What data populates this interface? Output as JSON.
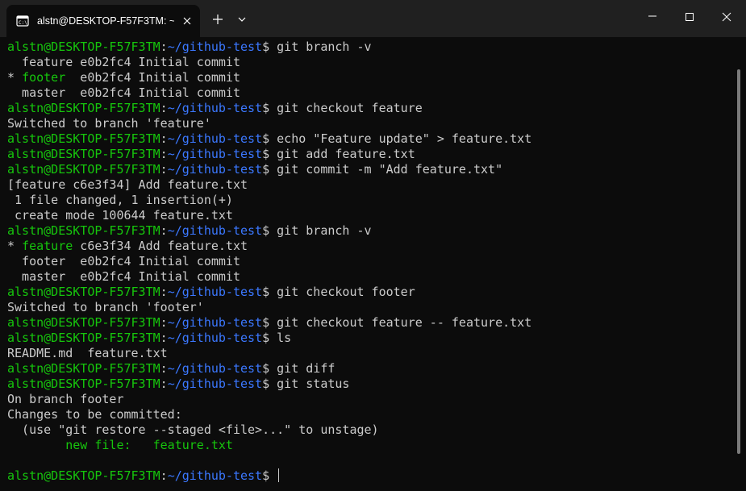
{
  "window": {
    "tab_title": "alstn@DESKTOP-F57F3TM: ~/",
    "tab_icon": "terminal-icon",
    "new_tab_icon": "plus-icon",
    "dropdown_icon": "chevron-down-icon",
    "minimize_icon": "minimize-icon",
    "maximize_icon": "maximize-icon",
    "close_icon": "close-icon"
  },
  "colors": {
    "background": "#0c0c0c",
    "titlebar": "#202020",
    "prompt_user": "#16c60c",
    "prompt_path": "#3b78ff",
    "text": "#cccccc"
  },
  "terminal": {
    "lines": [
      {
        "kind": "prompt",
        "user": "alstn@DESKTOP-F57F3TM",
        "sep": ":",
        "path": "~/github-test",
        "sym": "$ ",
        "cmd": "git branch -v"
      },
      {
        "kind": "out",
        "segs": [
          {
            "t": "  feature e0b2fc4 Initial commit"
          }
        ]
      },
      {
        "kind": "out",
        "segs": [
          {
            "t": "* "
          },
          {
            "t": "footer",
            "c": "green"
          },
          {
            "t": "  e0b2fc4 Initial commit"
          }
        ]
      },
      {
        "kind": "out",
        "segs": [
          {
            "t": "  master  e0b2fc4 Initial commit"
          }
        ]
      },
      {
        "kind": "prompt",
        "user": "alstn@DESKTOP-F57F3TM",
        "sep": ":",
        "path": "~/github-test",
        "sym": "$ ",
        "cmd": "git checkout feature"
      },
      {
        "kind": "out",
        "segs": [
          {
            "t": "Switched to branch 'feature'"
          }
        ]
      },
      {
        "kind": "prompt",
        "user": "alstn@DESKTOP-F57F3TM",
        "sep": ":",
        "path": "~/github-test",
        "sym": "$ ",
        "cmd": "echo \"Feature update\" > feature.txt"
      },
      {
        "kind": "prompt",
        "user": "alstn@DESKTOP-F57F3TM",
        "sep": ":",
        "path": "~/github-test",
        "sym": "$ ",
        "cmd": "git add feature.txt"
      },
      {
        "kind": "prompt",
        "user": "alstn@DESKTOP-F57F3TM",
        "sep": ":",
        "path": "~/github-test",
        "sym": "$ ",
        "cmd": "git commit -m \"Add feature.txt\""
      },
      {
        "kind": "out",
        "segs": [
          {
            "t": "[feature c6e3f34] Add feature.txt"
          }
        ]
      },
      {
        "kind": "out",
        "segs": [
          {
            "t": " 1 file changed, 1 insertion(+)"
          }
        ]
      },
      {
        "kind": "out",
        "segs": [
          {
            "t": " create mode 100644 feature.txt"
          }
        ]
      },
      {
        "kind": "prompt",
        "user": "alstn@DESKTOP-F57F3TM",
        "sep": ":",
        "path": "~/github-test",
        "sym": "$ ",
        "cmd": "git branch -v"
      },
      {
        "kind": "out",
        "segs": [
          {
            "t": "* "
          },
          {
            "t": "feature",
            "c": "green"
          },
          {
            "t": " c6e3f34 Add feature.txt"
          }
        ]
      },
      {
        "kind": "out",
        "segs": [
          {
            "t": "  footer  e0b2fc4 Initial commit"
          }
        ]
      },
      {
        "kind": "out",
        "segs": [
          {
            "t": "  master  e0b2fc4 Initial commit"
          }
        ]
      },
      {
        "kind": "prompt",
        "user": "alstn@DESKTOP-F57F3TM",
        "sep": ":",
        "path": "~/github-test",
        "sym": "$ ",
        "cmd": "git checkout footer"
      },
      {
        "kind": "out",
        "segs": [
          {
            "t": "Switched to branch 'footer'"
          }
        ]
      },
      {
        "kind": "prompt",
        "user": "alstn@DESKTOP-F57F3TM",
        "sep": ":",
        "path": "~/github-test",
        "sym": "$ ",
        "cmd": "git checkout feature -- feature.txt"
      },
      {
        "kind": "prompt",
        "user": "alstn@DESKTOP-F57F3TM",
        "sep": ":",
        "path": "~/github-test",
        "sym": "$ ",
        "cmd": "ls"
      },
      {
        "kind": "out",
        "segs": [
          {
            "t": "README.md  feature.txt"
          }
        ]
      },
      {
        "kind": "prompt",
        "user": "alstn@DESKTOP-F57F3TM",
        "sep": ":",
        "path": "~/github-test",
        "sym": "$ ",
        "cmd": "git diff"
      },
      {
        "kind": "prompt",
        "user": "alstn@DESKTOP-F57F3TM",
        "sep": ":",
        "path": "~/github-test",
        "sym": "$ ",
        "cmd": "git status"
      },
      {
        "kind": "out",
        "segs": [
          {
            "t": "On branch footer"
          }
        ]
      },
      {
        "kind": "out",
        "segs": [
          {
            "t": "Changes to be committed:"
          }
        ]
      },
      {
        "kind": "out",
        "segs": [
          {
            "t": "  (use \"git restore --staged <file>...\" to unstage)"
          }
        ]
      },
      {
        "kind": "out",
        "segs": [
          {
            "t": "        new file:   feature.txt",
            "c": "green"
          }
        ]
      },
      {
        "kind": "out",
        "segs": [
          {
            "t": ""
          }
        ]
      },
      {
        "kind": "prompt",
        "user": "alstn@DESKTOP-F57F3TM",
        "sep": ":",
        "path": "~/github-test",
        "sym": "$ ",
        "cmd": "",
        "cursor": true
      }
    ]
  }
}
